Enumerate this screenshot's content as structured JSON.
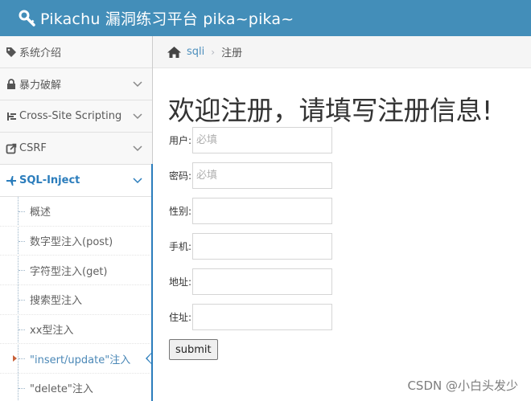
{
  "header": {
    "title": "Pikachu 漏洞练习平台 pika~pika~",
    "icon": "wrench-icon"
  },
  "sidebar": {
    "items": [
      {
        "label": "系统介绍",
        "icon": "tag-icon"
      },
      {
        "label": "暴力破解",
        "icon": "lock-icon"
      },
      {
        "label": "Cross-Site Scripting",
        "icon": "list-icon"
      },
      {
        "label": "CSRF",
        "icon": "external-link-icon"
      },
      {
        "label": "SQL-Inject",
        "icon": "plane-icon"
      }
    ],
    "sub_items": [
      "概述",
      "数字型注入(post)",
      "字符型注入(get)",
      "搜索型注入",
      "xx型注入",
      "\"insert/update\"注入",
      "\"delete\"注入"
    ]
  },
  "breadcrumb": {
    "parent": "sqli",
    "current": "注册"
  },
  "main": {
    "heading": "欢迎注册，请填写注册信息!",
    "fields": [
      {
        "label": "用户:",
        "placeholder": "必填"
      },
      {
        "label": "密码:",
        "placeholder": "必填"
      },
      {
        "label": "性别:",
        "placeholder": ""
      },
      {
        "label": "手机:",
        "placeholder": ""
      },
      {
        "label": "地址:",
        "placeholder": ""
      },
      {
        "label": "住址:",
        "placeholder": ""
      }
    ],
    "submit_label": "submit"
  },
  "watermark": "CSDN @小白头发少",
  "colors": {
    "header_bg": "#438eb9",
    "accent": "#2b7dbc",
    "link": "#4c8fbd"
  }
}
